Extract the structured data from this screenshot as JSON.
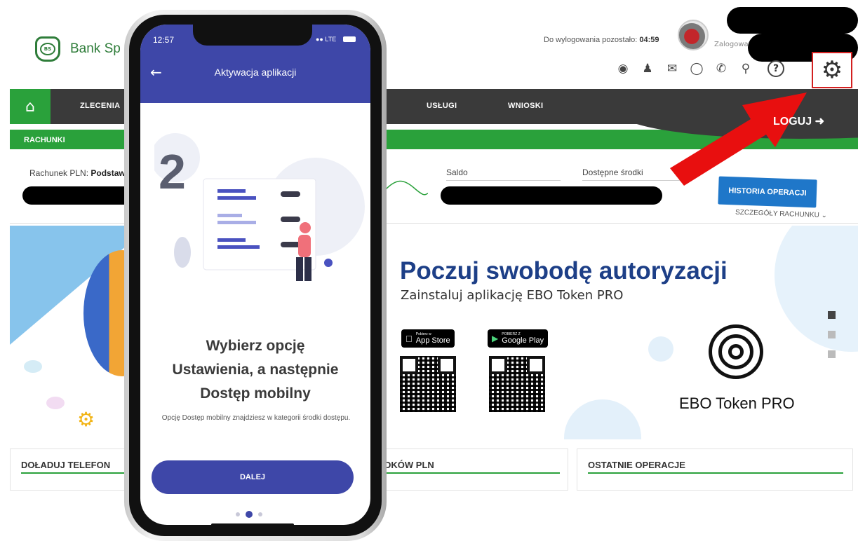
{
  "bank": {
    "name": "Bank Sp",
    "logo_text": "BS",
    "session_label": "Do wylogowania pozostało:",
    "session_time": "04:59",
    "logged_label": "Zalogowan"
  },
  "nav": {
    "items": [
      "ZLECENIA",
      "USŁUGI",
      "WNIOSKI"
    ],
    "logout": "LOGUJ"
  },
  "accounts": {
    "section": "RACHUNKI",
    "account_label": "Rachunek PLN:",
    "account_name": "Podstaw",
    "balance_label": "Saldo",
    "available_label": "Dostępne środki",
    "history_button": "HISTORIA OPERACJI",
    "details_link": "SZCZEGÓŁY RACHUNKU"
  },
  "banner": {
    "headline": "Poczuj swobodę autoryzacji",
    "subline": "Zainstaluj aplikację EBO Token PRO",
    "app_store_small": "Pobierz w",
    "app_store": "App Store",
    "google_play_small": "POBIERZ Z",
    "google_play": "Google Play",
    "product": "EBO Token PRO"
  },
  "widgets": {
    "left": "DOŁADUJ TELEFON",
    "middle": "DKÓW PLN",
    "right": "OSTATNIE OPERACJE"
  },
  "phone": {
    "time": "12:57",
    "network": "LTE",
    "title": "Aktywacja aplikacji",
    "step_number": "2",
    "step_line1": "Wybierz opcję",
    "step_line2": "Ustawienia, a następnie",
    "step_line3": "Dostęp mobilny",
    "step_sub": "Opcję Dostęp mobilny znajdziesz w kategorii środki dostępu.",
    "button": "DALEJ",
    "pager_active_index": 1,
    "pager_count": 3
  },
  "colors": {
    "brand_green": "#2aa13b",
    "nav_dark": "#3a3a3a",
    "app_blue": "#3e47a8",
    "history_blue": "#1f77c9",
    "headline_navy": "#1d3f87",
    "highlight_red": "#d32020"
  },
  "icons": [
    "dashboard-icon",
    "user-icon",
    "mail-icon",
    "chat-icon",
    "phone-icon",
    "location-icon",
    "help-icon",
    "settings-gear-icon"
  ]
}
